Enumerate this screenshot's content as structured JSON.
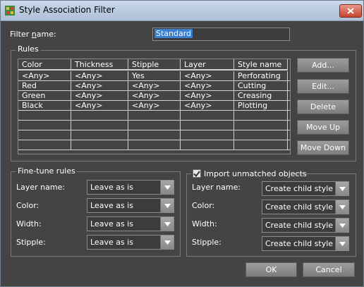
{
  "window": {
    "title": "Style Association Filter"
  },
  "filter_name": {
    "label_pre": "Filter ",
    "label_u": "n",
    "label_post": "ame:",
    "value": "Standard"
  },
  "rules": {
    "group_label": "Rules",
    "columns": [
      "Color",
      "Thickness",
      "Stipple",
      "Layer",
      "Style name"
    ],
    "rows": [
      [
        "<Any>",
        "<Any>",
        "Yes",
        "<Any>",
        "Perforating"
      ],
      [
        "Red",
        "<Any>",
        "<Any>",
        "<Any>",
        "Cutting"
      ],
      [
        "Green",
        "<Any>",
        "<Any>",
        "<Any>",
        "Creasing"
      ],
      [
        "Black",
        "<Any>",
        "<Any>",
        "<Any>",
        "Plotting"
      ]
    ],
    "buttons": {
      "add": "Add...",
      "edit": "Edit...",
      "delete": "Delete",
      "move_up": "Move Up",
      "move_down": "Move Down"
    }
  },
  "fine_tune": {
    "group_label": "Fine-tune rules",
    "layer_label": "Layer name:",
    "layer_value": "Leave as is",
    "color_label": "Color:",
    "color_value": "Leave as is",
    "width_label": "Width:",
    "width_value": "Leave as is",
    "stipple_label": "Stipple:",
    "stipple_value": "Leave as is"
  },
  "import": {
    "group_label": "Import unmatched objects",
    "checked": true,
    "layer_label": "Layer name:",
    "layer_value": "Create child style",
    "color_label": "Color:",
    "color_value": "Create child style",
    "width_label": "Width:",
    "width_value": "Create child style",
    "stipple_label": "Stipple:",
    "stipple_value": "Create child style"
  },
  "footer": {
    "ok": "OK",
    "cancel": "Cancel"
  },
  "icons": {
    "app": "app-icon",
    "close": "close-icon",
    "dropdown": "chevron-down-icon",
    "check": "check-icon"
  }
}
